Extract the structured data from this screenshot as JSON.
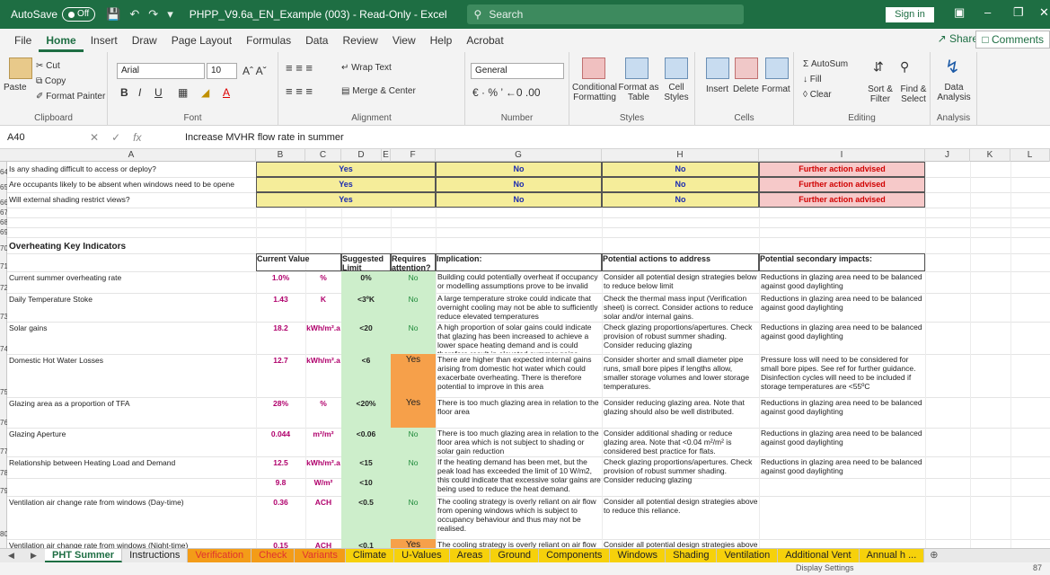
{
  "titlebar": {
    "autosave_label": "AutoSave",
    "autosave_state": "Off",
    "doc_title": "PHPP_V9.6a_EN_Example (003)  -  Read-Only  -  Excel",
    "search_placeholder": "Search",
    "signin": "Sign in"
  },
  "ribbon_tabs": [
    "File",
    "Home",
    "Insert",
    "Draw",
    "Page Layout",
    "Formulas",
    "Data",
    "Review",
    "View",
    "Help",
    "Acrobat"
  ],
  "ribbon_actions": {
    "share": "Share",
    "comments": "Comments"
  },
  "ribbon": {
    "clipboard": {
      "paste": "Paste",
      "cut": "Cut",
      "copy": "Copy",
      "format_painter": "Format Painter",
      "label": "Clipboard"
    },
    "font": {
      "name": "Arial",
      "size": "10",
      "bold": "B",
      "italic": "I",
      "underline": "U",
      "label": "Font"
    },
    "alignment": {
      "wrap": "Wrap Text",
      "merge": "Merge & Center",
      "label": "Alignment"
    },
    "number": {
      "format": "General",
      "label": "Number"
    },
    "styles": {
      "conditional": "Conditional Formatting",
      "format_table": "Format as Table",
      "cell_styles": "Cell Styles",
      "label": "Styles"
    },
    "cells": {
      "insert": "Insert",
      "delete": "Delete",
      "format": "Format",
      "label": "Cells"
    },
    "editing": {
      "autosum": "AutoSum",
      "fill": "Fill",
      "clear": "Clear",
      "sort": "Sort & Filter",
      "find": "Find & Select",
      "label": "Editing"
    },
    "analysis": {
      "data_analysis": "Data Analysis",
      "label": "Analysis"
    }
  },
  "formula_bar": {
    "cell_ref": "A40",
    "formula": "Increase MVHR flow rate in summer"
  },
  "columns": [
    "A",
    "B",
    "C",
    "D",
    "E",
    "F",
    "G",
    "H",
    "I",
    "J",
    "K",
    "L"
  ],
  "row_numbers": [
    "64",
    "65",
    "66",
    "67",
    "68",
    "69",
    "70",
    "71",
    "72",
    "73",
    "74",
    "75",
    "76",
    "77",
    "78",
    "79",
    "80"
  ],
  "shading_rows": [
    {
      "question": "Is any shading difficult to access or deploy?",
      "b": "Yes",
      "g": "No",
      "h": "No",
      "i": "Further action advised"
    },
    {
      "question": "Are occupants likely to be absent when windows need to be opene",
      "b": "Yes",
      "g": "No",
      "h": "No",
      "i": "Further action advised"
    },
    {
      "question": "Will external shading restrict views?",
      "b": "Yes",
      "g": "No",
      "h": "No",
      "i": "Further action advised"
    }
  ],
  "indicators_title": "Overheating Key Indicators",
  "indicator_headers": {
    "current": "Current Value",
    "suggested": "Suggested Limit",
    "attention": "Requires attention?",
    "implication": "Implication:",
    "actions": "Potential actions to address",
    "secondary": "Potential secondary impacts:"
  },
  "indicators": [
    {
      "name": "Current summer overheating rate",
      "value": "1.0%",
      "unit": "%",
      "limit": "0%",
      "attention": "No",
      "implication": "Building could potentially overheat if occupancy or modelling assumptions prove to be invalid",
      "actions": "Consider all potential design strategies below to reduce below limit",
      "secondary": "Reductions in glazing area need to be balanced against good daylighting"
    },
    {
      "name": "Daily Temperature Stoke",
      "value": "1.43",
      "unit": "K",
      "limit": "<3ºK",
      "attention": "No",
      "implication": "A large temperature stroke could indicate that overnight cooling may not be able to sufficiently reduce elevated temperatures",
      "actions": "Check the thermal mass input (Verification sheet) is correct.  Consider actions to reduce solar and/or internal gains.",
      "secondary": "Reductions in glazing area need to be balanced against good daylighting"
    },
    {
      "name": "Solar gains",
      "value": "18.2",
      "unit": "kWh/m².a",
      "limit": "<20",
      "attention": "No",
      "implication": "A high proportion of solar gains could indicate that glazing has been increased to achieve a lower space heating demand and is could therefore result in elevated summer gains",
      "actions": "Check glazing proportions/apertures.  Check provision of robust summer shading.  Consider reducing glazing",
      "secondary": "Reductions in glazing area need to be balanced against good daylighting"
    },
    {
      "name": "Domestic Hot Water Losses",
      "value": "12.7",
      "unit": "kWh/m².a",
      "limit": "<6",
      "attention": "Yes",
      "implication": "There are higher than expected internal gains arising from domestic hot water which could exacerbate overheating.  There is therefore potential to improve in this area",
      "actions": "Consider shorter and small diameter pipe runs, small bore pipes if lengths allow, smaller storage volumes and lower storage temperatures.",
      "secondary": "Pressure loss will need to be considered for small bore pipes.  See ref for further guidance. Disinfection cycles will need to be included if storage temperatures are <55ºC"
    },
    {
      "name": "Glazing area as a proportion of TFA",
      "value": "28%",
      "unit": "%",
      "limit": "<20%",
      "attention": "Yes",
      "implication": "There is too much glazing area in relation to the floor area",
      "actions": "Consider reducing glazing area.  Note that glazing should also be well distributed.",
      "secondary": "Reductions in glazing area need to be balanced against good daylighting"
    },
    {
      "name": "Glazing Aperture",
      "value": "0.044",
      "unit": "m²/m²",
      "limit": "<0.06",
      "attention": "No",
      "implication": "There is too much glazing area in relation to the floor area which is not subject to shading or solar gain reduction",
      "actions": "Consider additional shading or reduce glazing area.  Note that <0.04 m²/m² is considered best practice for flats.",
      "secondary": "Reductions in glazing area need to be balanced against good daylighting"
    },
    {
      "name": "Relationship between Heating Load and Demand",
      "value": "12.5",
      "unit": "kWh/m².a",
      "limit": "<15",
      "attention": "No",
      "value2": "9.8",
      "unit2": "W/m²",
      "limit2": "<10",
      "implication": "If the heating demand has been met, but the peak load has exceeded the limit of 10 W/m2, this could indicate that excessive solar gains are being used to reduce the heat demand.",
      "actions": "Check glazing proportions/apertures.  Check provision of robust summer shading.  Consider reducing glazing",
      "secondary": "Reductions in glazing area need to be balanced against good daylighting"
    },
    {
      "name": "Ventilation air change rate from windows (Day-time)",
      "value": "0.36",
      "unit": "ACH",
      "limit": "<0.5",
      "attention": "No",
      "implication": "The cooling strategy is overly reliant on air flow from opening windows which is subject to occupancy behaviour and thus may not be realised.",
      "actions": "Consider all potential design strategies above to reduce this reliance.",
      "secondary": ""
    },
    {
      "name": "Ventilation air change rate from windows (Night-time)",
      "value": "0.15",
      "unit": "ACH",
      "limit": "<0.1",
      "attention": "Yes",
      "implication": "The cooling strategy is overly reliant on air flow",
      "actions": "Consider all potential design strategies above to",
      "secondary": ""
    }
  ],
  "sheet_tabs": [
    {
      "label": "PHT Summer",
      "style": "active"
    },
    {
      "label": "Instructions",
      "style": "plain"
    },
    {
      "label": "Verification",
      "style": "red"
    },
    {
      "label": "Check",
      "style": "red"
    },
    {
      "label": "Variants",
      "style": "red"
    },
    {
      "label": "Climate",
      "style": "yellow"
    },
    {
      "label": "U-Values",
      "style": "yellow"
    },
    {
      "label": "Areas",
      "style": "yellow"
    },
    {
      "label": "Ground",
      "style": "yellow"
    },
    {
      "label": "Components",
      "style": "yellow"
    },
    {
      "label": "Windows",
      "style": "yellow"
    },
    {
      "label": "Shading",
      "style": "yellow"
    },
    {
      "label": "Ventilation",
      "style": "yellow"
    },
    {
      "label": "Additional Vent",
      "style": "yellow"
    },
    {
      "label": "Annual h ...",
      "style": "yellow"
    }
  ],
  "status": {
    "display_settings": "Display Settings",
    "zoom": "87"
  },
  "colors": {
    "excel_green": "#1e6e43",
    "yes_yellow": "#f5ed9a",
    "advised_pink": "#f6c9c9",
    "limit_green": "#cdeecb",
    "attention_orange": "#f6a04a"
  }
}
